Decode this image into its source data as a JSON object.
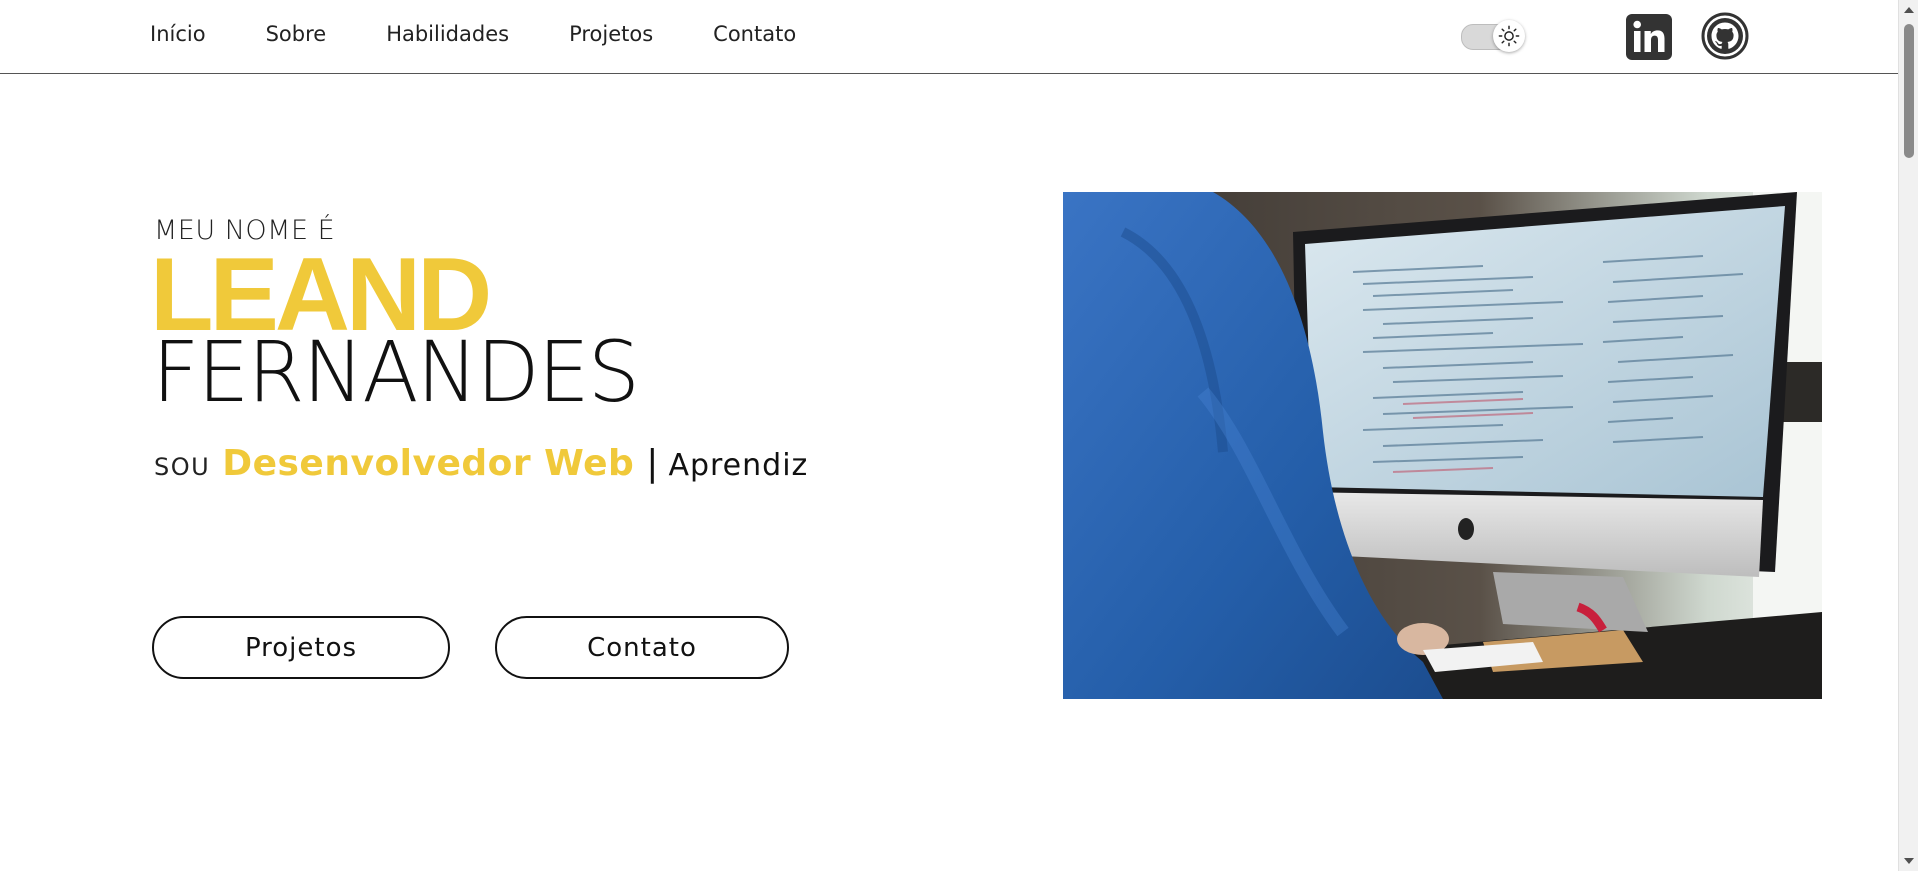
{
  "nav": {
    "links": [
      "Início",
      "Sobre",
      "Habilidades",
      "Projetos",
      "Contato"
    ],
    "theme_icon": "sun-icon",
    "social": {
      "linkedin_icon": "linkedin-icon",
      "github_icon": "github-icon"
    }
  },
  "hero": {
    "intro": "MEU NOME É",
    "first_name": "LEAND",
    "last_name": "FERNANDES",
    "prefix": "SOU",
    "role": "Desenvolvedor Web",
    "separator": "|",
    "extra": "Aprendiz",
    "buttons": {
      "projects": "Projetos",
      "contact": "Contato"
    }
  },
  "colors": {
    "accent": "#f0c93a",
    "text": "#111111",
    "background": "#ffffff"
  }
}
